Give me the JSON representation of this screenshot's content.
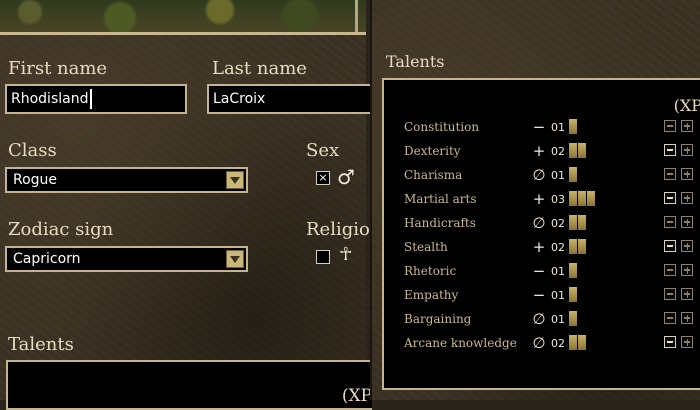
{
  "character": {
    "first_name_label": "First name",
    "first_name_value": "Rhodisland",
    "last_name_label": "Last name",
    "last_name_value": "LaCroix",
    "class_label": "Class",
    "class_value": "Rogue",
    "sex_label": "Sex",
    "sex_checkbox_mark": "×",
    "male_symbol": "♂",
    "zodiac_label": "Zodiac sign",
    "zodiac_value": "Capricorn",
    "religion_label": "Religio",
    "religion_symbol": "☥",
    "talents_label": "Talents",
    "xp_label": "(XP"
  },
  "talents_panel": {
    "title": "Talents",
    "xp_label": "(XP",
    "talents": [
      {
        "name": "Constitution",
        "sign": "−",
        "value": "01",
        "bars": 1,
        "minus_active": false,
        "plus_active": false
      },
      {
        "name": "Dexterity",
        "sign": "+",
        "value": "02",
        "bars": 2,
        "minus_active": true,
        "plus_active": false
      },
      {
        "name": "Charisma",
        "sign": "∅",
        "value": "01",
        "bars": 1,
        "minus_active": false,
        "plus_active": false
      },
      {
        "name": "Martial arts",
        "sign": "+",
        "value": "03",
        "bars": 3,
        "minus_active": true,
        "plus_active": false
      },
      {
        "name": "Handicrafts",
        "sign": "∅",
        "value": "02",
        "bars": 2,
        "minus_active": false,
        "plus_active": false
      },
      {
        "name": "Stealth",
        "sign": "+",
        "value": "02",
        "bars": 2,
        "minus_active": true,
        "plus_active": false
      },
      {
        "name": "Rhetoric",
        "sign": "−",
        "value": "01",
        "bars": 1,
        "minus_active": false,
        "plus_active": false
      },
      {
        "name": "Empathy",
        "sign": "−",
        "value": "01",
        "bars": 1,
        "minus_active": false,
        "plus_active": false
      },
      {
        "name": "Bargaining",
        "sign": "∅",
        "value": "01",
        "bars": 1,
        "minus_active": false,
        "plus_active": false
      },
      {
        "name": "Arcane knowledge",
        "sign": "∅",
        "value": "02",
        "bars": 2,
        "minus_active": true,
        "plus_active": false
      }
    ]
  },
  "colors": {
    "label_text": "#e8dcc0",
    "talent_name": "#c9b98f",
    "field_border": "#c4b48f",
    "bar_gold": "#c8b36a"
  },
  "icons": [
    "dropdown-arrow-icon",
    "male-symbol-icon",
    "ankh-icon",
    "minus-button-icon",
    "plus-button-icon"
  ]
}
